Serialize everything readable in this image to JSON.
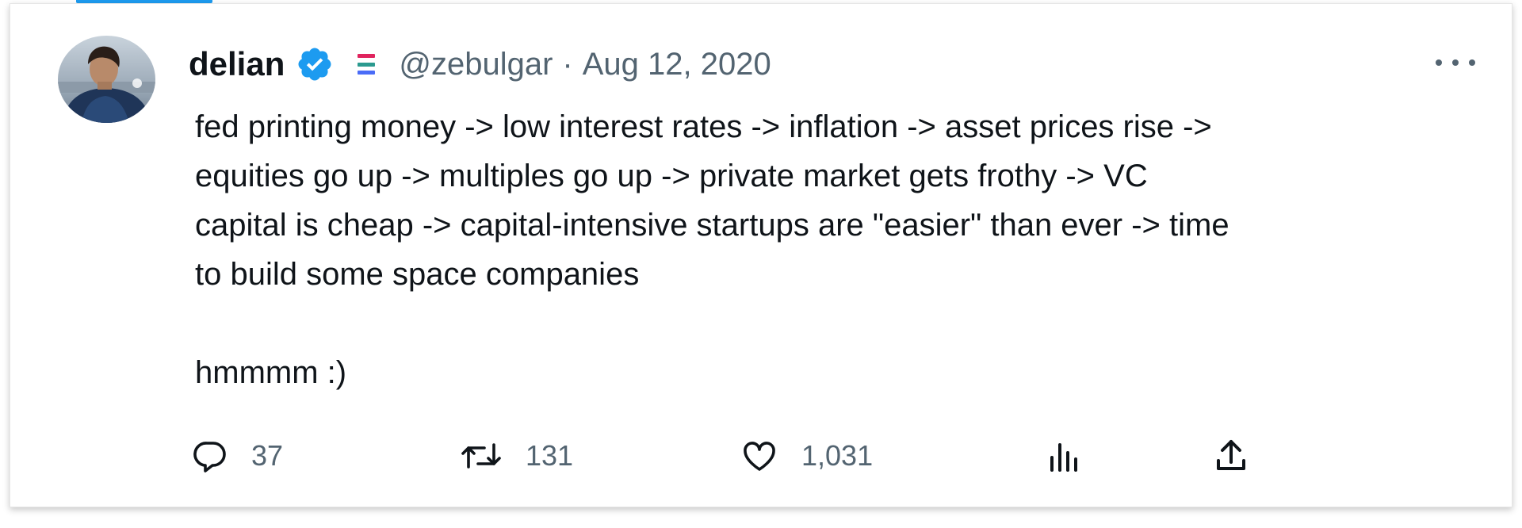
{
  "author": {
    "display_name": "delian",
    "handle": "@zebulgar",
    "separator": "·",
    "date": "Aug 12, 2020",
    "verified_icon": "verified-badge-icon",
    "flag_icon": "flag-icon"
  },
  "tweet": {
    "lines": [
      "fed printing money -> low interest rates -> inflation -> asset prices rise ->",
      "equities go up -> multiples go up -> private market gets frothy -> VC",
      "capital is cheap -> capital-intensive startups are \"easier\" than ever -> time",
      "to build some space companies"
    ],
    "closing": "hmmmm :)"
  },
  "actions": {
    "reply": {
      "icon": "reply-icon",
      "count": "37"
    },
    "retweet": {
      "icon": "retweet-icon",
      "count": "131"
    },
    "like": {
      "icon": "heart-icon",
      "count": "1,031"
    },
    "views": {
      "icon": "analytics-icon"
    },
    "share": {
      "icon": "share-icon"
    }
  },
  "menu": {
    "icon": "more-options-icon"
  },
  "colors": {
    "accent": "#1d9bf0",
    "text": "#0f1419",
    "muted": "#536471"
  }
}
